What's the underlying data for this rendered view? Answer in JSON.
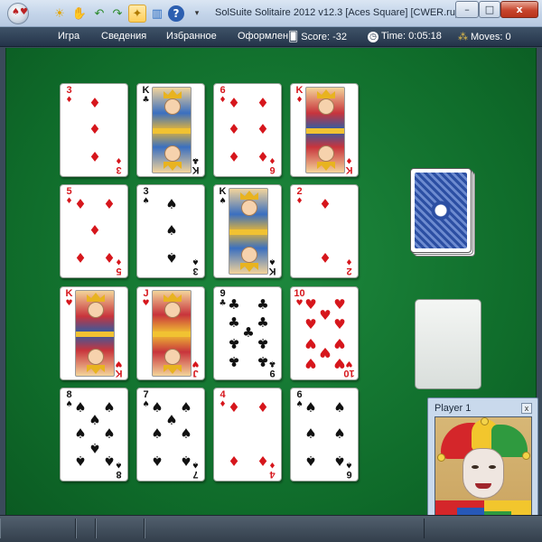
{
  "window": {
    "title": "SolSuite Solitaire 2012 v12.3  [Aces Square]  [CWER.ru]",
    "minimize_label": "–",
    "maximize_label": "□",
    "close_label": "x"
  },
  "menu": {
    "items": [
      "Игра",
      "Сведения",
      "Избранное",
      "Оформлен"
    ]
  },
  "stats": {
    "score_label": "Score:",
    "score_value": "-32",
    "time_label": "Time:",
    "time_value": "0:05:18",
    "moves_label": "Moves:",
    "moves_value": "0"
  },
  "tableau": [
    {
      "rank": "3",
      "suit": "♦",
      "color": "red",
      "kind": "pips"
    },
    {
      "rank": "K",
      "suit": "♣",
      "color": "black",
      "kind": "king"
    },
    {
      "rank": "6",
      "suit": "♦",
      "color": "red",
      "kind": "pips"
    },
    {
      "rank": "K",
      "suit": "♦",
      "color": "red",
      "kind": "king"
    },
    {
      "rank": "5",
      "suit": "♦",
      "color": "red",
      "kind": "pips"
    },
    {
      "rank": "3",
      "suit": "♠",
      "color": "black",
      "kind": "pips"
    },
    {
      "rank": "K",
      "suit": "♠",
      "color": "black",
      "kind": "king"
    },
    {
      "rank": "2",
      "suit": "♦",
      "color": "red",
      "kind": "pips"
    },
    {
      "rank": "K",
      "suit": "♥",
      "color": "red",
      "kind": "king"
    },
    {
      "rank": "J",
      "suit": "♥",
      "color": "red",
      "kind": "jack"
    },
    {
      "rank": "9",
      "suit": "♣",
      "color": "black",
      "kind": "pips"
    },
    {
      "rank": "10",
      "suit": "♥",
      "color": "red",
      "kind": "pips"
    },
    {
      "rank": "8",
      "suit": "♠",
      "color": "black",
      "kind": "pips"
    },
    {
      "rank": "7",
      "suit": "♠",
      "color": "black",
      "kind": "pips"
    },
    {
      "rank": "4",
      "suit": "♦",
      "color": "red",
      "kind": "pips"
    },
    {
      "rank": "6",
      "suit": "♠",
      "color": "black",
      "kind": "pips"
    }
  ],
  "player": {
    "name": "Player 1",
    "close_label": "x"
  },
  "colors": {
    "felt": "#0f6b2a",
    "card_red": "#d6161c",
    "card_black": "#111111",
    "card_back": "#2c4fa3"
  },
  "toolbar_icons": [
    "app-orb-icon",
    "sun-icon",
    "hand-icon",
    "undo-icon",
    "redo-icon",
    "hint-icon",
    "stats-icon",
    "help-icon",
    "dropdown-icon"
  ],
  "stat_icons": [
    "score-cards-icon",
    "clock-icon",
    "footsteps-icon"
  ]
}
